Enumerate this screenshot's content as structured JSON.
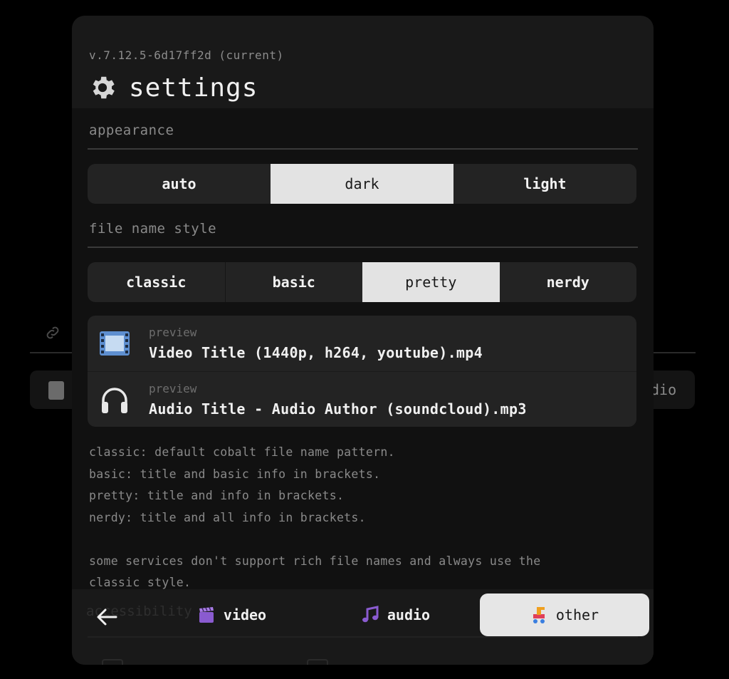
{
  "background": {
    "right_chip_text": "dio"
  },
  "settings": {
    "version": "v.7.12.5-6d17ff2d (current)",
    "title": "settings",
    "appearance": {
      "label": "appearance",
      "options": [
        "auto",
        "dark",
        "light"
      ],
      "selected": "dark"
    },
    "file_name_style": {
      "label": "file name style",
      "options": [
        "classic",
        "basic",
        "pretty",
        "nerdy"
      ],
      "selected": "pretty"
    },
    "preview": {
      "video": {
        "label": "preview",
        "name": "Video Title (1440p, h264, youtube).mp4",
        "icon": "film-icon"
      },
      "audio": {
        "label": "preview",
        "name": "Audio Title - Audio Author (soundcloud).mp3",
        "icon": "headphones-icon"
      }
    },
    "description": "classic: default cobalt file name pattern.\nbasic: title and basic info in brackets.\npretty: title and info in brackets.\nnerdy: title and all info in brackets.\n\nsome services don't support rich file names and always use the\nclassic style."
  },
  "nav": {
    "tabs": [
      {
        "label": "video",
        "icon": "clapper-icon"
      },
      {
        "label": "audio",
        "icon": "music-notes-icon"
      },
      {
        "label": "other",
        "icon": "toy-horse-icon"
      }
    ],
    "active": "other",
    "hidden_section_label": "accessibility"
  },
  "colors": {
    "accent_active": "#e3e3e3",
    "panel": "#191919",
    "button": "#232323"
  }
}
